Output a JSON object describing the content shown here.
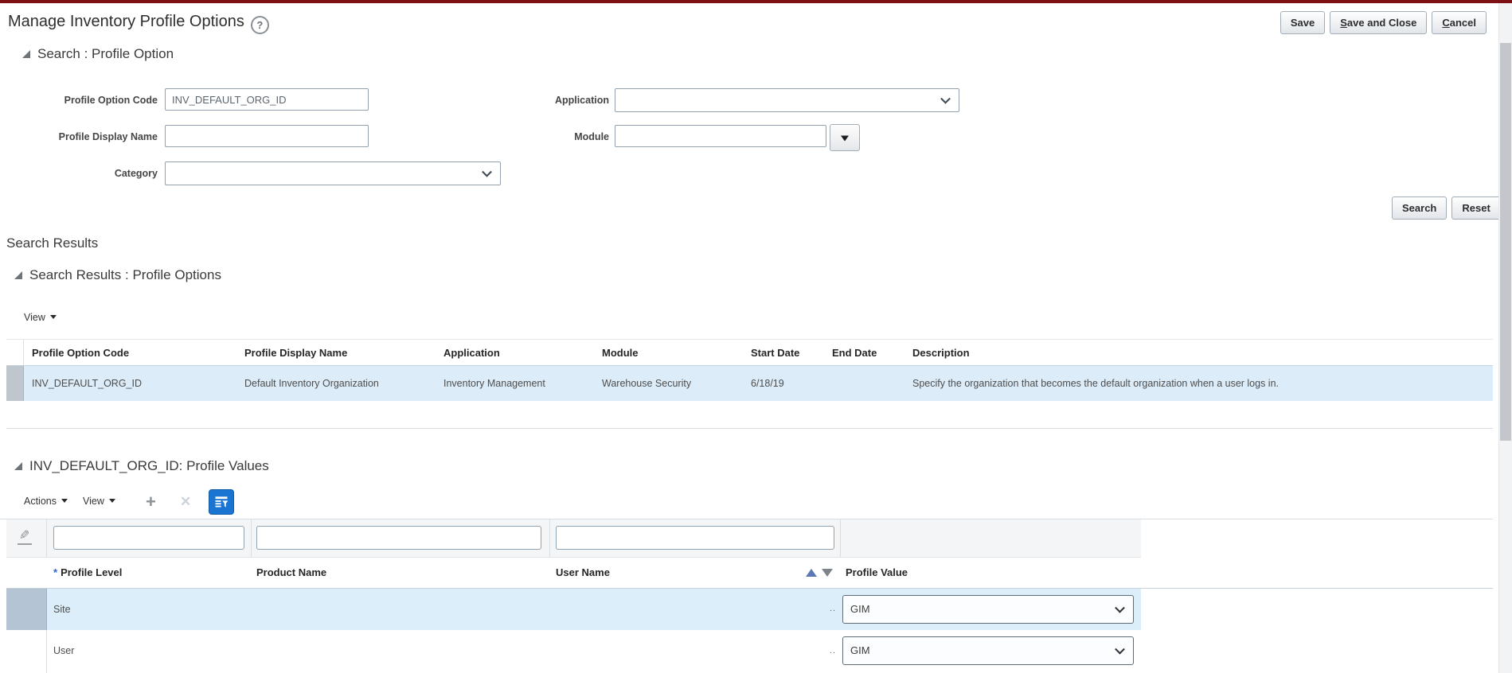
{
  "colors": {
    "top_bar": "#7c1013",
    "accent_blue": "#1a75d2",
    "selected_row": "#ddeefb",
    "selected_gutter": "#b5c4d4"
  },
  "header": {
    "title": "Manage Inventory Profile Options",
    "help_glyph": "?",
    "buttons": {
      "save": "Save",
      "save_and_close_u": "S",
      "save_and_close_rest": "ave and Close",
      "cancel_u": "C",
      "cancel_rest": "ancel"
    }
  },
  "search": {
    "heading": "Search : Profile Option",
    "profile_option_code_label": "Profile Option Code",
    "profile_option_code_value": "INV_DEFAULT_ORG_ID",
    "profile_display_name_label": "Profile Display Name",
    "profile_display_name_value": "",
    "category_label": "Category",
    "application_label": "Application",
    "module_label": "Module",
    "module_value": "",
    "search_button": "Search",
    "reset_button": "Reset"
  },
  "results": {
    "section_title": "Search Results",
    "heading": "Search Results : Profile Options",
    "view_label": "View",
    "columns": [
      "Profile Option Code",
      "Profile Display Name",
      "Application",
      "Module",
      "Start Date",
      "End Date",
      "Description"
    ],
    "row": {
      "profile_option_code": "INV_DEFAULT_ORG_ID",
      "profile_display_name": "Default Inventory Organization",
      "application": "Inventory Management",
      "module": "Warehouse Security",
      "start_date": "6/18/19",
      "end_date": "",
      "description": "Specify the organization that becomes the default organization when a user logs in."
    }
  },
  "profile_values": {
    "heading": "INV_DEFAULT_ORG_ID: Profile Values",
    "actions_label": "Actions",
    "view_label": "View",
    "required_marker": "*",
    "columns": {
      "profile_level": "Profile Level",
      "product_name": "Product Name",
      "user_name": "User Name",
      "profile_value": "Profile Value"
    },
    "filters": {
      "profile_level": "",
      "product_name": "",
      "user_name": ""
    },
    "ellipsis": "..",
    "rows": [
      {
        "profile_level": "Site",
        "profile_value": "GIM"
      },
      {
        "profile_level": "User",
        "profile_value": "GIM"
      }
    ]
  }
}
